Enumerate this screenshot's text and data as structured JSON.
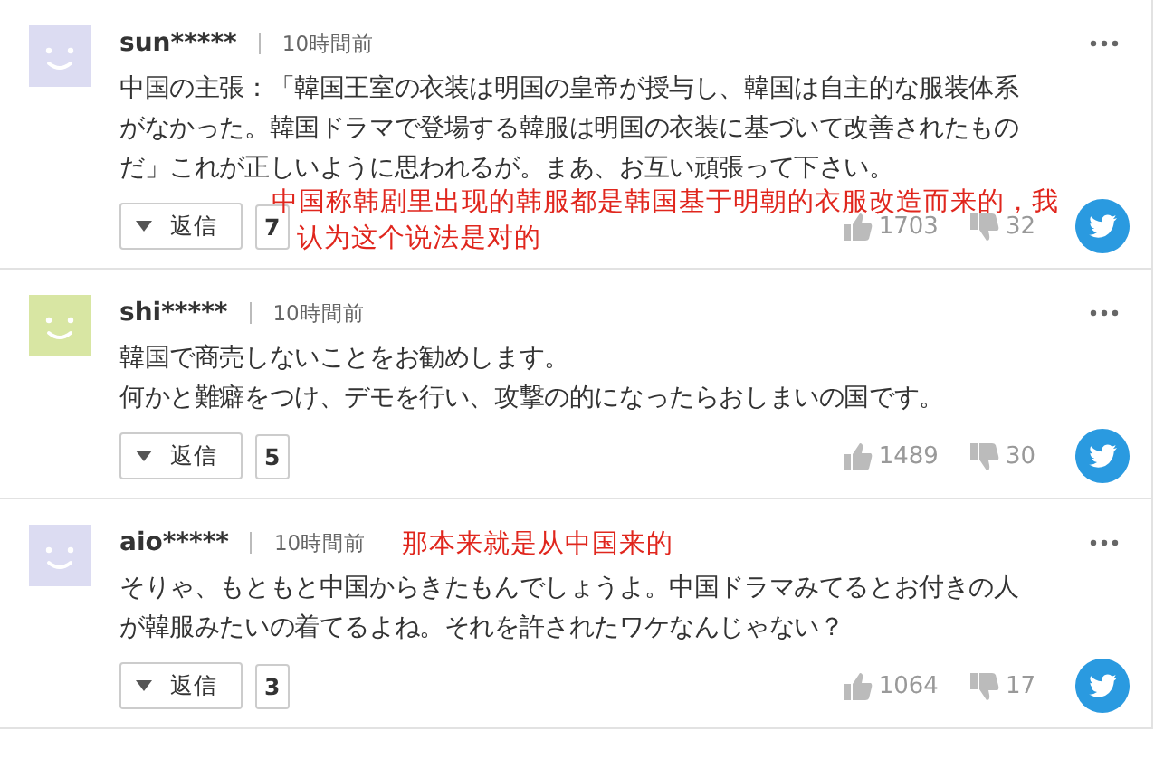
{
  "comments": [
    {
      "user": "sun*****",
      "time": "10時間前",
      "color": "#dcdcf2",
      "lines": [
        "中国の主張：「韓国王室の衣装は明国の皇帝が授与し、韓国は自主的な服装体系",
        "がなかった。韓国ドラマで登場する韓服は明国の衣装に基づいて改善されたもの",
        "だ」これが正しいように思われるが。まあ、お互い頑張って下さい。"
      ],
      "reply_label": "返信",
      "replies": "7",
      "likes": "1703",
      "dislikes": "32",
      "annotation": {
        "lines": [
          "中国称韩剧里出现的韩服都是韩国基于明朝的衣服改造而来的，我",
          "认为这个说法是对的"
        ],
        "kind": "below"
      }
    },
    {
      "user": "shi*****",
      "time": "10時間前",
      "color": "#d8e6a3",
      "lines": [
        "韓国で商売しないことをお勧めします。",
        "何かと難癖をつけ、デモを行い、攻撃の的になったらおしまいの国です。"
      ],
      "reply_label": "返信",
      "replies": "5",
      "likes": "1489",
      "dislikes": "30"
    },
    {
      "user": "aio*****",
      "time": "10時間前",
      "color": "#dcdcf2",
      "lines": [
        "そりゃ、もともと中国からきたもんでしょうよ。中国ドラマみてるとお付きの人",
        "が韓服みたいの着てるよね。それを許されたワケなんじゃない？"
      ],
      "reply_label": "返信",
      "replies": "3",
      "likes": "1064",
      "dislikes": "17",
      "annotation": {
        "lines": [
          "那本来就是从中国来的"
        ],
        "kind": "header"
      }
    }
  ]
}
